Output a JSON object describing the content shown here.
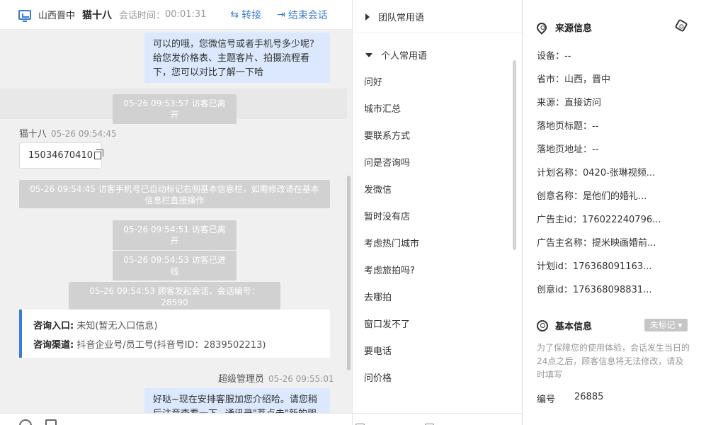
{
  "chat_header": {
    "region": "山西晋中",
    "visitor_name": "猫十八",
    "session_time_label": "会话时间：",
    "session_time": "00:01:31",
    "transfer_label": "转接",
    "end_label": "结束会话"
  },
  "messages": {
    "agent_bubble_1": "可以的哦，您微信号或者手机号多少呢?给您发价格表、主题客片、拍摄流程看下，您可以对比了解一下哈",
    "sys_1": "05-26 09:53:57 访客已离开",
    "visitor_name": "猫十八",
    "visitor_time": "05-26 09:54:45",
    "phone": "15034670410",
    "sys_2": "05-26 09:54:45 访客手机号已自动标记右侧基本信息栏，如需修改请在基本信息栏直接操作",
    "sys_3": "05-26 09:54:51 访客已离开",
    "sys_4": "05-26 09:54:53 访客已进线",
    "sys_5": "05-26 09:54:53 顾客发起会话，会话编号：28590",
    "entry_label": "咨询入口:",
    "entry_value": "未知(暂无入口信息)",
    "channel_label": "咨询渠道:",
    "channel_value": "抖音企业号/员工号(抖音号ID：2839502213)",
    "admin_name": "超级管理员",
    "admin_time": "05-26 09:55:01",
    "agent_bubble_2": "好哒~现在安排客服加您介绍哈。请您稍后注意查看一下~通讯录\"莘点击\"新的朋"
  },
  "phrases": {
    "team_group": "团队常用语",
    "personal_group": "个人常用语",
    "items": [
      "问好",
      "城市汇总",
      "要联系方式",
      "问是咨询吗",
      "发微信",
      "暂时没有店",
      "考虑热门城市",
      "考虑旅拍吗?",
      "去哪拍",
      "窗口发不了",
      "要电话",
      "问价格"
    ]
  },
  "info": {
    "source_title": "来源信息",
    "device": "设备：--",
    "province": "省市：山西，晋中",
    "source": "来源：直接访问",
    "landing_title": "落地页标题：--",
    "landing_url": "落地页地址：--",
    "plan_name": "计划名称：0420-张琳视频...",
    "creative_name": "创意名称：是他们的婚礼...",
    "advertiser_id": "广告主id：176022240796...",
    "advertiser_name": "广告主名称：提米映画婚前...",
    "plan_id": "计划id：176368091163...",
    "creative_id": "创意id：176368098831...",
    "basic_title": "基本信息",
    "tag_badge": "未标记",
    "note": "为了保障您的使用体验，会话发生当日的24点之后，顾客信息将无法修改，请及时填写",
    "number_label": "编号",
    "number_value": "26885"
  },
  "colors": {
    "accent": "#3a7bd5",
    "agent_bubble": "#dbe8fd",
    "system_msg": "#d1d1d1"
  }
}
